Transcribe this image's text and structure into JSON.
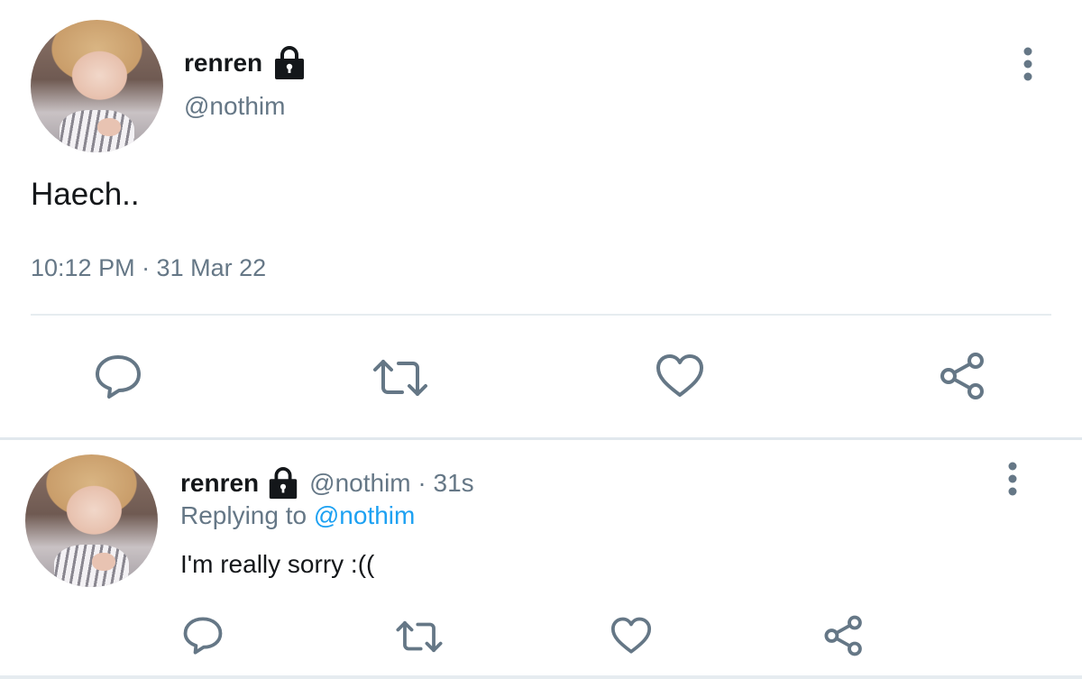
{
  "main_tweet": {
    "display_name": "renren",
    "handle": "@nothim",
    "text": "Haech..",
    "timestamp": "10:12 PM · 31 Mar 22",
    "icons": {
      "protected": "lock-icon",
      "more": "more-vertical-icon",
      "reply": "reply-icon",
      "retweet": "retweet-icon",
      "like": "heart-icon",
      "share": "share-icon"
    }
  },
  "reply_tweet": {
    "display_name": "renren",
    "handle_time": "@nothim · 31s",
    "replying_prefix": "Replying to",
    "replying_mention": "@nothim",
    "text": "I'm really sorry :(("
  },
  "colors": {
    "text_primary": "#14171a",
    "text_secondary": "#657786",
    "accent": "#1da1f2",
    "divider": "#e6ecf0",
    "icon": "#657786"
  }
}
